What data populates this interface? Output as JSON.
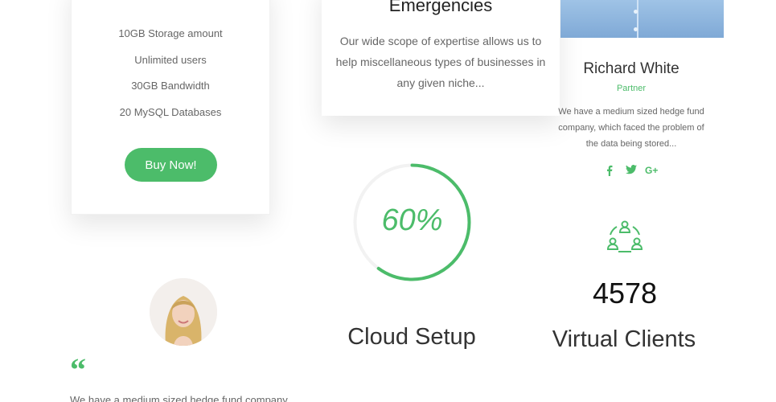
{
  "pricing": {
    "features": [
      "10GB Storage amount",
      "Unlimited users",
      "30GB Bandwidth",
      "20 MySQL Databases"
    ],
    "button_label": "Buy Now!"
  },
  "service": {
    "title": "Emergencies",
    "text": "Our wide scope of expertise allows us to help miscellaneous types of businesses in any given niche..."
  },
  "team_member": {
    "name": "Richard White",
    "role": "Partner",
    "bio": "We have a medium sized hedge fund company, which faced the problem of the data being stored...",
    "social": [
      {
        "icon": "facebook-icon",
        "glyph": "f"
      },
      {
        "icon": "twitter-icon",
        "glyph": "🐦"
      },
      {
        "icon": "google-plus-icon",
        "glyph": "G+"
      }
    ]
  },
  "progress": {
    "value_text": "60%",
    "value": 0.6,
    "label": "Cloud Setup"
  },
  "counter": {
    "icon": "network-people-icon",
    "value": "4578",
    "label": "Virtual Clients"
  },
  "testimonial": {
    "quote_mark": "“",
    "text": "We have a medium sized hedge fund company"
  },
  "colors": {
    "accent": "#4cbc6a",
    "text": "#666666",
    "heading": "#333333"
  }
}
